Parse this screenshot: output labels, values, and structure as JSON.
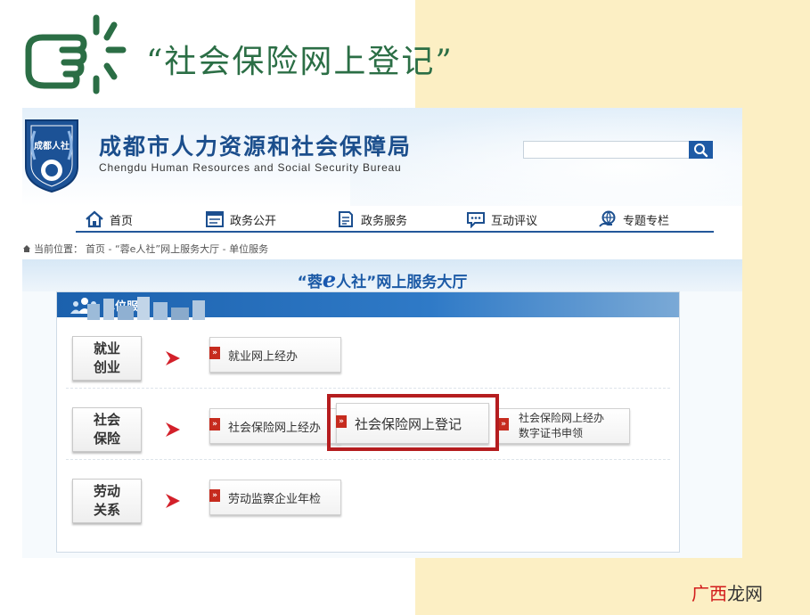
{
  "slide": {
    "title": "“社会保险网上登记”"
  },
  "site": {
    "name_cn": "成都市人力资源和社会保障局",
    "name_en": "Chengdu Human Resources and Social Security Bureau",
    "logo_text": "成都人社",
    "search_placeholder": ""
  },
  "nav": [
    {
      "label": "首页",
      "icon": "home-icon"
    },
    {
      "label": "政务公开",
      "icon": "browser-window-icon"
    },
    {
      "label": "政务服务",
      "icon": "document-icon"
    },
    {
      "label": "互动评议",
      "icon": "chat-bubble-icon"
    },
    {
      "label": "专题专栏",
      "icon": "globe-hand-icon"
    }
  ],
  "breadcrumb": {
    "label": "当前位置：",
    "path": "首页 - “蓉e人社”网上服务大厅 - 单位服务"
  },
  "hall": {
    "title_prefix": "“蓉",
    "title_e": "e",
    "title_suffix": "人社”网上服务大厅"
  },
  "panel": {
    "title": "单位服务",
    "rows": [
      {
        "cat_line1": "就业",
        "cat_line2": "创业",
        "services": [
          "就业网上经办"
        ]
      },
      {
        "cat_line1": "社会",
        "cat_line2": "保险",
        "services": [
          "社会保险网上经办",
          "社会保险网上登记"
        ],
        "service_two_line": [
          "社会保险网上经办",
          "数字证书申领"
        ]
      },
      {
        "cat_line1": "劳动",
        "cat_line2": "关系",
        "services": [
          "劳动监察企业年检"
        ]
      }
    ]
  },
  "watermark": {
    "part1": "广西",
    "part2": "龙网"
  },
  "colors": {
    "slide_green": "#2b6e45",
    "brand_blue": "#1b4e8c",
    "highlight_red": "#b51d1f",
    "yellow_bg": "#fcefc4"
  }
}
